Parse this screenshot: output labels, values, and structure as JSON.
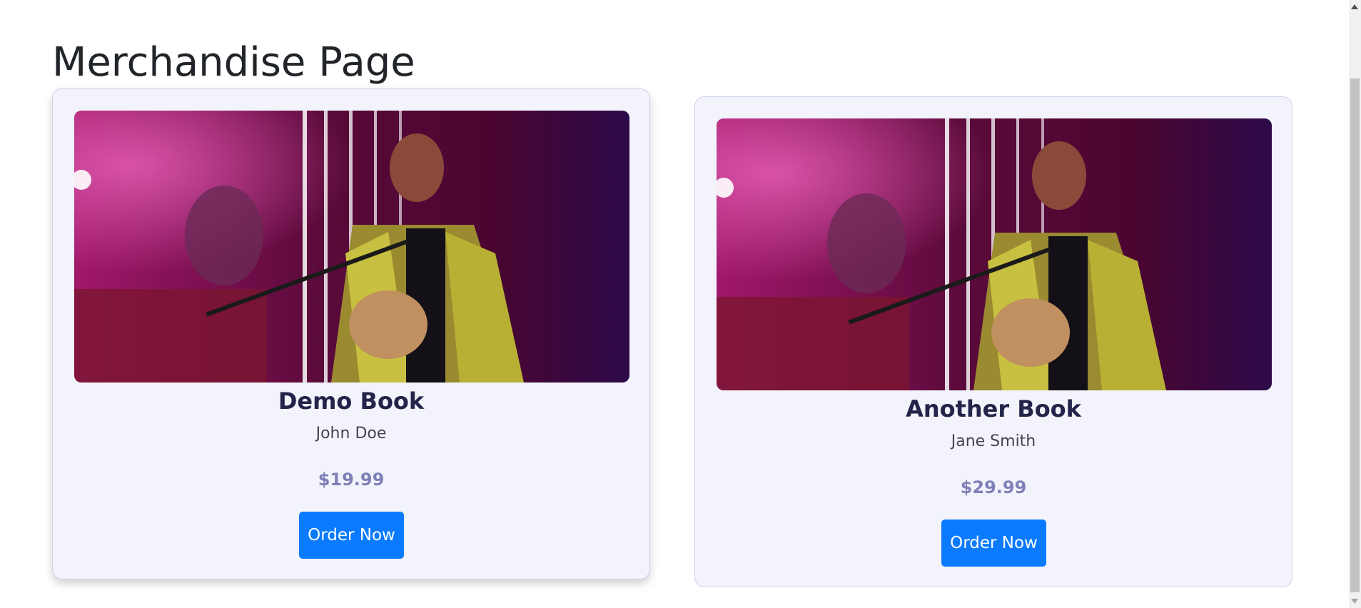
{
  "page": {
    "title": "Merchandise Page"
  },
  "products": [
    {
      "title": "Demo Book",
      "author": "John Doe",
      "price": "$19.99",
      "button_label": "Order Now",
      "image_alt": "musician-photo"
    },
    {
      "title": "Another Book",
      "author": "Jane Smith",
      "price": "$29.99",
      "button_label": "Order Now",
      "image_alt": "musician-photo"
    }
  ],
  "colors": {
    "card_bg": "#f3f3fb",
    "button_bg": "#0a7bff",
    "title_text": "#23244a",
    "price_text": "#7e80b8"
  }
}
